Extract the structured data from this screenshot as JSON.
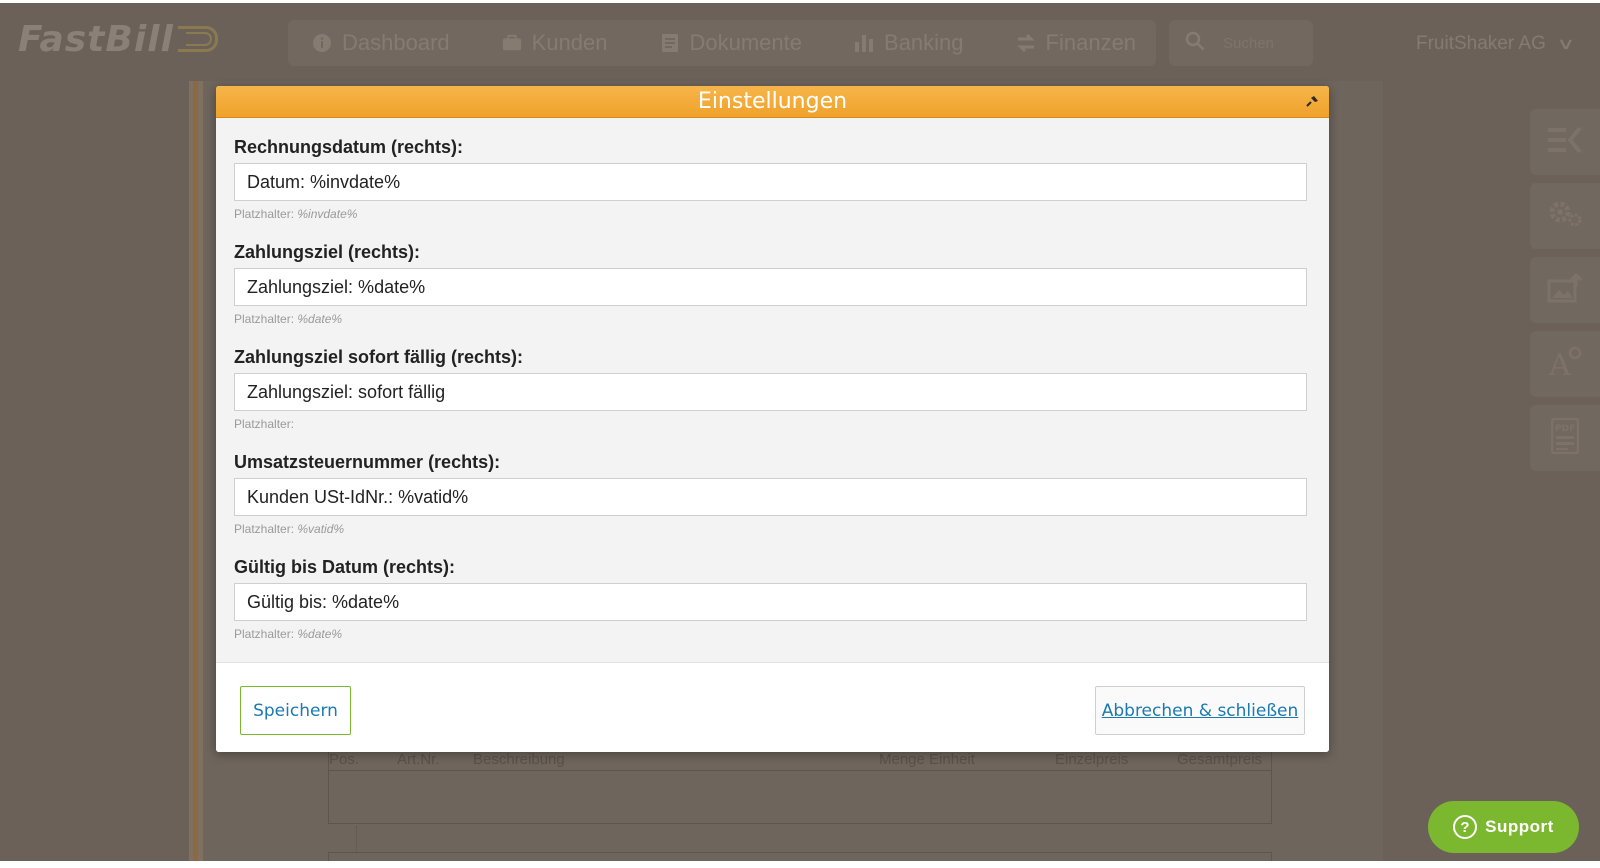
{
  "app": {
    "logo_text": "FastBill",
    "nav": [
      {
        "label": "Dashboard",
        "icon": "info-circle-icon"
      },
      {
        "label": "Kunden",
        "icon": "briefcase-icon"
      },
      {
        "label": "Dokumente",
        "icon": "document-icon"
      },
      {
        "label": "Banking",
        "icon": "bar-chart-icon"
      },
      {
        "label": "Finanzen",
        "icon": "transfer-arrows-icon"
      }
    ],
    "search_placeholder": "Suchen",
    "company": "FruitShaker AG",
    "support_label": "Support"
  },
  "document": {
    "columns": [
      "Pos.",
      "Art.Nr.",
      "Beschreibung",
      "Menge Einheit",
      "Einzelpreis",
      "Gesamtpreis"
    ]
  },
  "modal": {
    "title": "Einstellungen",
    "fields": [
      {
        "label": "Rechnungsdatum (rechts):",
        "value": "Datum: %invdate%",
        "hint_prefix": "Platzhalter: ",
        "hint_placeholders": "%invdate%"
      },
      {
        "label": "Zahlungsziel (rechts):",
        "value": "Zahlungsziel: %date%",
        "hint_prefix": "Platzhalter: ",
        "hint_placeholders": "%date%"
      },
      {
        "label": "Zahlungsziel sofort fällig (rechts):",
        "value": "Zahlungsziel: sofort fällig",
        "hint_prefix": "Platzhalter:",
        "hint_placeholders": ""
      },
      {
        "label": "Umsatzsteuernummer (rechts):",
        "value": "Kunden USt-IdNr.: %vatid%",
        "hint_prefix": "Platzhalter: ",
        "hint_placeholders": "%vatid%"
      },
      {
        "label": "Gültig bis Datum (rechts):",
        "value": "Gültig bis: %date%",
        "hint_prefix": "Platzhalter: ",
        "hint_placeholders": "%date%"
      }
    ],
    "save_label": "Speichern",
    "cancel_label": "Abbrechen & schließen"
  },
  "colors": {
    "header_orange": "#f0a22b",
    "accent_green": "#7cb82f",
    "link_blue": "#1a7ab0"
  }
}
